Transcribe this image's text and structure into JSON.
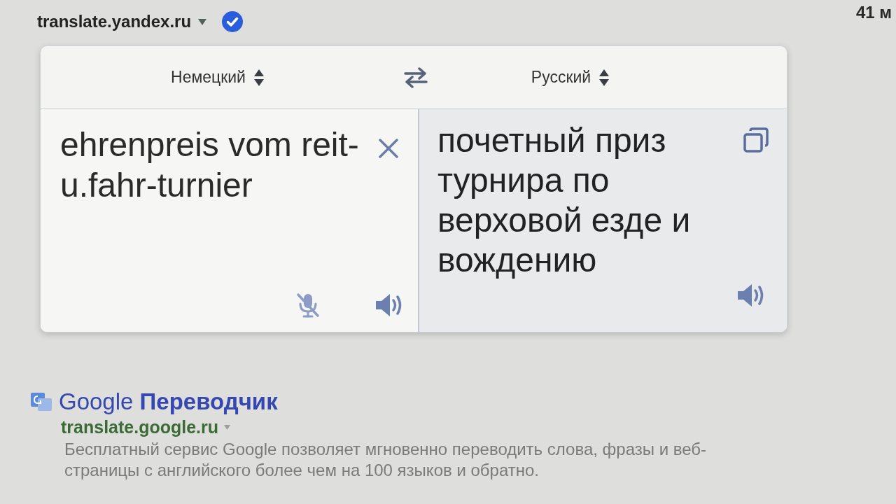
{
  "top_result": {
    "url": "translate.yandex.ru"
  },
  "corner_text": "41 м",
  "translator": {
    "source_language": "Немецкий",
    "target_language": "Русский",
    "source_text": "ehrenpreis vom reit-u.fahr-turnier",
    "translation": "почетный приз турнира по верховой езде и вождению"
  },
  "result": {
    "title": "Google **Переводчик**",
    "url": "translate.google.ru",
    "snippet": "Бесплатный сервис Google позволяет мгновенно переводить слова, фразы и веб-страницы с английского более чем на 100 языков и обратно."
  }
}
